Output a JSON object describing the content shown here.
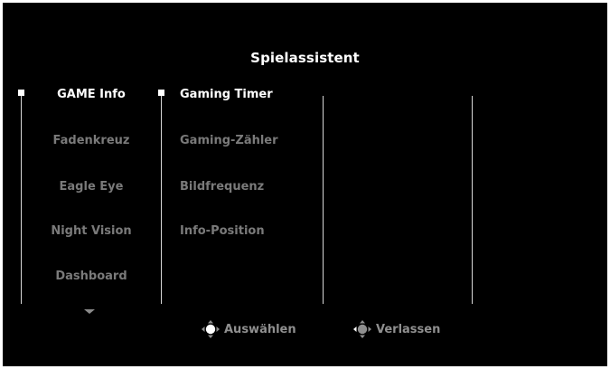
{
  "title": "Spielassistent",
  "menu_left": {
    "items": [
      {
        "label": "GAME Info",
        "state": "active"
      },
      {
        "label": "Fadenkreuz",
        "state": "inactive"
      },
      {
        "label": "Eagle Eye",
        "state": "inactive"
      },
      {
        "label": "Night Vision",
        "state": "inactive"
      },
      {
        "label": "Dashboard",
        "state": "inactive"
      }
    ],
    "more_indicator_icon": "triangle-down-icon"
  },
  "menu_sub": {
    "items": [
      {
        "label": "Gaming Timer",
        "state": "active"
      },
      {
        "label": "Gaming-Zähler",
        "state": "inactive"
      },
      {
        "label": "Bildfrequenz",
        "state": "inactive"
      },
      {
        "label": "Info-Position",
        "state": "inactive"
      }
    ]
  },
  "hints": {
    "select": {
      "label": "Auswählen",
      "icon": "joystick-press-icon"
    },
    "exit": {
      "label": "Verlassen",
      "icon": "joystick-left-icon"
    }
  },
  "colors": {
    "background": "#000000",
    "active_text": "#ffffff",
    "inactive_text": "#7a7a7a",
    "divider": "#d8d8d8"
  }
}
